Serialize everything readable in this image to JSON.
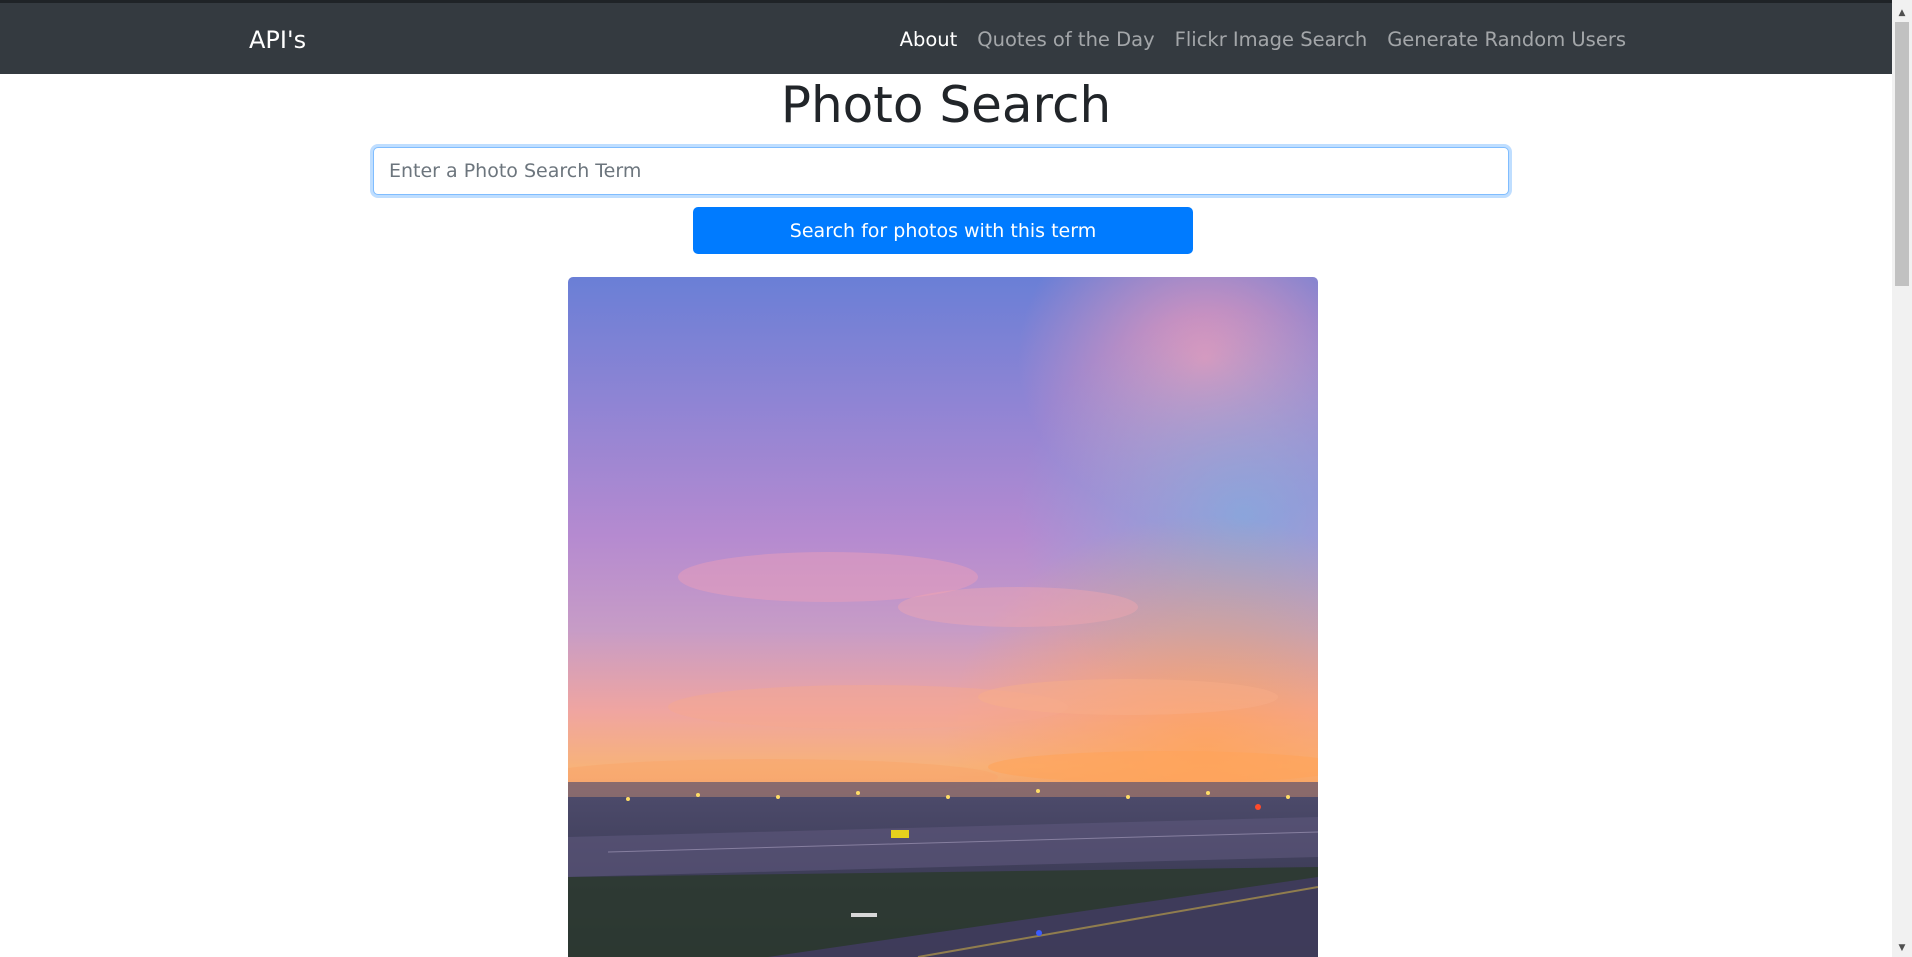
{
  "navbar": {
    "brand": "API's",
    "links": [
      {
        "label": "About",
        "active": true
      },
      {
        "label": "Quotes of the Day",
        "active": false
      },
      {
        "label": "Flickr Image Search",
        "active": false
      },
      {
        "label": "Generate Random Users",
        "active": false
      }
    ]
  },
  "main": {
    "title": "Photo Search",
    "search": {
      "value": "",
      "placeholder": "Enter a Photo Search Term"
    },
    "search_button_label": "Search for photos with this term"
  },
  "colors": {
    "navbar_bg": "#343a40",
    "primary": "#007bff",
    "focus_border": "#80bdff"
  },
  "icons": {
    "scroll_up": "triangle-up",
    "scroll_down": "triangle-down"
  }
}
